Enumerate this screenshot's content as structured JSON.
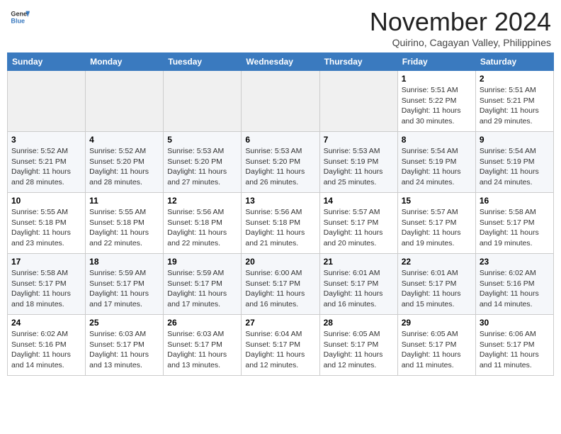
{
  "header": {
    "logo_line1": "General",
    "logo_line2": "Blue",
    "month": "November 2024",
    "location": "Quirino, Cagayan Valley, Philippines"
  },
  "weekdays": [
    "Sunday",
    "Monday",
    "Tuesday",
    "Wednesday",
    "Thursday",
    "Friday",
    "Saturday"
  ],
  "weeks": [
    [
      {
        "day": "",
        "info": ""
      },
      {
        "day": "",
        "info": ""
      },
      {
        "day": "",
        "info": ""
      },
      {
        "day": "",
        "info": ""
      },
      {
        "day": "",
        "info": ""
      },
      {
        "day": "1",
        "info": "Sunrise: 5:51 AM\nSunset: 5:22 PM\nDaylight: 11 hours\nand 30 minutes."
      },
      {
        "day": "2",
        "info": "Sunrise: 5:51 AM\nSunset: 5:21 PM\nDaylight: 11 hours\nand 29 minutes."
      }
    ],
    [
      {
        "day": "3",
        "info": "Sunrise: 5:52 AM\nSunset: 5:21 PM\nDaylight: 11 hours\nand 28 minutes."
      },
      {
        "day": "4",
        "info": "Sunrise: 5:52 AM\nSunset: 5:20 PM\nDaylight: 11 hours\nand 28 minutes."
      },
      {
        "day": "5",
        "info": "Sunrise: 5:53 AM\nSunset: 5:20 PM\nDaylight: 11 hours\nand 27 minutes."
      },
      {
        "day": "6",
        "info": "Sunrise: 5:53 AM\nSunset: 5:20 PM\nDaylight: 11 hours\nand 26 minutes."
      },
      {
        "day": "7",
        "info": "Sunrise: 5:53 AM\nSunset: 5:19 PM\nDaylight: 11 hours\nand 25 minutes."
      },
      {
        "day": "8",
        "info": "Sunrise: 5:54 AM\nSunset: 5:19 PM\nDaylight: 11 hours\nand 24 minutes."
      },
      {
        "day": "9",
        "info": "Sunrise: 5:54 AM\nSunset: 5:19 PM\nDaylight: 11 hours\nand 24 minutes."
      }
    ],
    [
      {
        "day": "10",
        "info": "Sunrise: 5:55 AM\nSunset: 5:18 PM\nDaylight: 11 hours\nand 23 minutes."
      },
      {
        "day": "11",
        "info": "Sunrise: 5:55 AM\nSunset: 5:18 PM\nDaylight: 11 hours\nand 22 minutes."
      },
      {
        "day": "12",
        "info": "Sunrise: 5:56 AM\nSunset: 5:18 PM\nDaylight: 11 hours\nand 22 minutes."
      },
      {
        "day": "13",
        "info": "Sunrise: 5:56 AM\nSunset: 5:18 PM\nDaylight: 11 hours\nand 21 minutes."
      },
      {
        "day": "14",
        "info": "Sunrise: 5:57 AM\nSunset: 5:17 PM\nDaylight: 11 hours\nand 20 minutes."
      },
      {
        "day": "15",
        "info": "Sunrise: 5:57 AM\nSunset: 5:17 PM\nDaylight: 11 hours\nand 19 minutes."
      },
      {
        "day": "16",
        "info": "Sunrise: 5:58 AM\nSunset: 5:17 PM\nDaylight: 11 hours\nand 19 minutes."
      }
    ],
    [
      {
        "day": "17",
        "info": "Sunrise: 5:58 AM\nSunset: 5:17 PM\nDaylight: 11 hours\nand 18 minutes."
      },
      {
        "day": "18",
        "info": "Sunrise: 5:59 AM\nSunset: 5:17 PM\nDaylight: 11 hours\nand 17 minutes."
      },
      {
        "day": "19",
        "info": "Sunrise: 5:59 AM\nSunset: 5:17 PM\nDaylight: 11 hours\nand 17 minutes."
      },
      {
        "day": "20",
        "info": "Sunrise: 6:00 AM\nSunset: 5:17 PM\nDaylight: 11 hours\nand 16 minutes."
      },
      {
        "day": "21",
        "info": "Sunrise: 6:01 AM\nSunset: 5:17 PM\nDaylight: 11 hours\nand 16 minutes."
      },
      {
        "day": "22",
        "info": "Sunrise: 6:01 AM\nSunset: 5:17 PM\nDaylight: 11 hours\nand 15 minutes."
      },
      {
        "day": "23",
        "info": "Sunrise: 6:02 AM\nSunset: 5:16 PM\nDaylight: 11 hours\nand 14 minutes."
      }
    ],
    [
      {
        "day": "24",
        "info": "Sunrise: 6:02 AM\nSunset: 5:16 PM\nDaylight: 11 hours\nand 14 minutes."
      },
      {
        "day": "25",
        "info": "Sunrise: 6:03 AM\nSunset: 5:17 PM\nDaylight: 11 hours\nand 13 minutes."
      },
      {
        "day": "26",
        "info": "Sunrise: 6:03 AM\nSunset: 5:17 PM\nDaylight: 11 hours\nand 13 minutes."
      },
      {
        "day": "27",
        "info": "Sunrise: 6:04 AM\nSunset: 5:17 PM\nDaylight: 11 hours\nand 12 minutes."
      },
      {
        "day": "28",
        "info": "Sunrise: 6:05 AM\nSunset: 5:17 PM\nDaylight: 11 hours\nand 12 minutes."
      },
      {
        "day": "29",
        "info": "Sunrise: 6:05 AM\nSunset: 5:17 PM\nDaylight: 11 hours\nand 11 minutes."
      },
      {
        "day": "30",
        "info": "Sunrise: 6:06 AM\nSunset: 5:17 PM\nDaylight: 11 hours\nand 11 minutes."
      }
    ]
  ]
}
